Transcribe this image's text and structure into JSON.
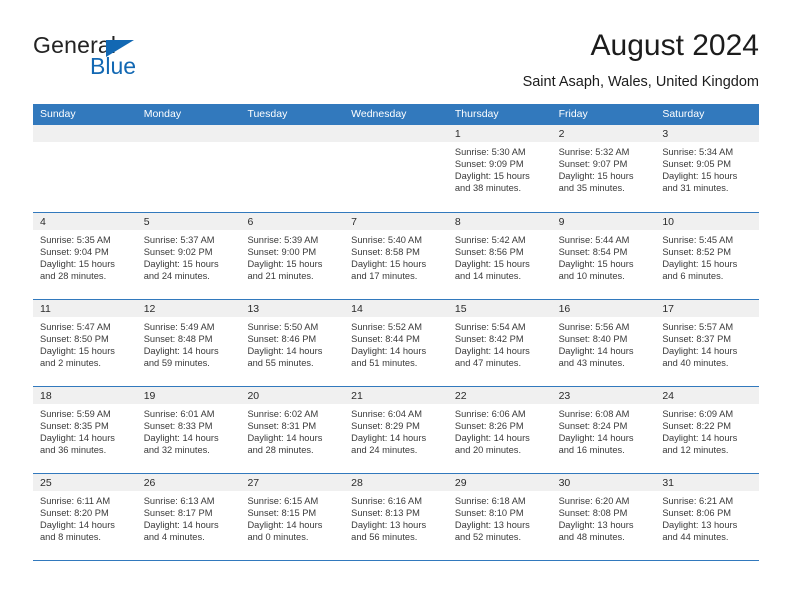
{
  "brand": {
    "name_top": "General",
    "name_bottom": "Blue",
    "accent_color": "#1268b3"
  },
  "header": {
    "title": "August 2024",
    "subtitle": "Saint Asaph, Wales, United Kingdom"
  },
  "calendar": {
    "header_bg": "#3279bd",
    "header_text_color": "#ffffff",
    "day_strip_bg": "#f0f0f0",
    "weekdays": [
      "Sunday",
      "Monday",
      "Tuesday",
      "Wednesday",
      "Thursday",
      "Friday",
      "Saturday"
    ],
    "weeks": [
      [
        {
          "day": "",
          "sunrise": "",
          "sunset": "",
          "daylight_line1": "",
          "daylight_line2": ""
        },
        {
          "day": "",
          "sunrise": "",
          "sunset": "",
          "daylight_line1": "",
          "daylight_line2": ""
        },
        {
          "day": "",
          "sunrise": "",
          "sunset": "",
          "daylight_line1": "",
          "daylight_line2": ""
        },
        {
          "day": "",
          "sunrise": "",
          "sunset": "",
          "daylight_line1": "",
          "daylight_line2": ""
        },
        {
          "day": "1",
          "sunrise": "Sunrise: 5:30 AM",
          "sunset": "Sunset: 9:09 PM",
          "daylight_line1": "Daylight: 15 hours",
          "daylight_line2": "and 38 minutes."
        },
        {
          "day": "2",
          "sunrise": "Sunrise: 5:32 AM",
          "sunset": "Sunset: 9:07 PM",
          "daylight_line1": "Daylight: 15 hours",
          "daylight_line2": "and 35 minutes."
        },
        {
          "day": "3",
          "sunrise": "Sunrise: 5:34 AM",
          "sunset": "Sunset: 9:05 PM",
          "daylight_line1": "Daylight: 15 hours",
          "daylight_line2": "and 31 minutes."
        }
      ],
      [
        {
          "day": "4",
          "sunrise": "Sunrise: 5:35 AM",
          "sunset": "Sunset: 9:04 PM",
          "daylight_line1": "Daylight: 15 hours",
          "daylight_line2": "and 28 minutes."
        },
        {
          "day": "5",
          "sunrise": "Sunrise: 5:37 AM",
          "sunset": "Sunset: 9:02 PM",
          "daylight_line1": "Daylight: 15 hours",
          "daylight_line2": "and 24 minutes."
        },
        {
          "day": "6",
          "sunrise": "Sunrise: 5:39 AM",
          "sunset": "Sunset: 9:00 PM",
          "daylight_line1": "Daylight: 15 hours",
          "daylight_line2": "and 21 minutes."
        },
        {
          "day": "7",
          "sunrise": "Sunrise: 5:40 AM",
          "sunset": "Sunset: 8:58 PM",
          "daylight_line1": "Daylight: 15 hours",
          "daylight_line2": "and 17 minutes."
        },
        {
          "day": "8",
          "sunrise": "Sunrise: 5:42 AM",
          "sunset": "Sunset: 8:56 PM",
          "daylight_line1": "Daylight: 15 hours",
          "daylight_line2": "and 14 minutes."
        },
        {
          "day": "9",
          "sunrise": "Sunrise: 5:44 AM",
          "sunset": "Sunset: 8:54 PM",
          "daylight_line1": "Daylight: 15 hours",
          "daylight_line2": "and 10 minutes."
        },
        {
          "day": "10",
          "sunrise": "Sunrise: 5:45 AM",
          "sunset": "Sunset: 8:52 PM",
          "daylight_line1": "Daylight: 15 hours",
          "daylight_line2": "and 6 minutes."
        }
      ],
      [
        {
          "day": "11",
          "sunrise": "Sunrise: 5:47 AM",
          "sunset": "Sunset: 8:50 PM",
          "daylight_line1": "Daylight: 15 hours",
          "daylight_line2": "and 2 minutes."
        },
        {
          "day": "12",
          "sunrise": "Sunrise: 5:49 AM",
          "sunset": "Sunset: 8:48 PM",
          "daylight_line1": "Daylight: 14 hours",
          "daylight_line2": "and 59 minutes."
        },
        {
          "day": "13",
          "sunrise": "Sunrise: 5:50 AM",
          "sunset": "Sunset: 8:46 PM",
          "daylight_line1": "Daylight: 14 hours",
          "daylight_line2": "and 55 minutes."
        },
        {
          "day": "14",
          "sunrise": "Sunrise: 5:52 AM",
          "sunset": "Sunset: 8:44 PM",
          "daylight_line1": "Daylight: 14 hours",
          "daylight_line2": "and 51 minutes."
        },
        {
          "day": "15",
          "sunrise": "Sunrise: 5:54 AM",
          "sunset": "Sunset: 8:42 PM",
          "daylight_line1": "Daylight: 14 hours",
          "daylight_line2": "and 47 minutes."
        },
        {
          "day": "16",
          "sunrise": "Sunrise: 5:56 AM",
          "sunset": "Sunset: 8:40 PM",
          "daylight_line1": "Daylight: 14 hours",
          "daylight_line2": "and 43 minutes."
        },
        {
          "day": "17",
          "sunrise": "Sunrise: 5:57 AM",
          "sunset": "Sunset: 8:37 PM",
          "daylight_line1": "Daylight: 14 hours",
          "daylight_line2": "and 40 minutes."
        }
      ],
      [
        {
          "day": "18",
          "sunrise": "Sunrise: 5:59 AM",
          "sunset": "Sunset: 8:35 PM",
          "daylight_line1": "Daylight: 14 hours",
          "daylight_line2": "and 36 minutes."
        },
        {
          "day": "19",
          "sunrise": "Sunrise: 6:01 AM",
          "sunset": "Sunset: 8:33 PM",
          "daylight_line1": "Daylight: 14 hours",
          "daylight_line2": "and 32 minutes."
        },
        {
          "day": "20",
          "sunrise": "Sunrise: 6:02 AM",
          "sunset": "Sunset: 8:31 PM",
          "daylight_line1": "Daylight: 14 hours",
          "daylight_line2": "and 28 minutes."
        },
        {
          "day": "21",
          "sunrise": "Sunrise: 6:04 AM",
          "sunset": "Sunset: 8:29 PM",
          "daylight_line1": "Daylight: 14 hours",
          "daylight_line2": "and 24 minutes."
        },
        {
          "day": "22",
          "sunrise": "Sunrise: 6:06 AM",
          "sunset": "Sunset: 8:26 PM",
          "daylight_line1": "Daylight: 14 hours",
          "daylight_line2": "and 20 minutes."
        },
        {
          "day": "23",
          "sunrise": "Sunrise: 6:08 AM",
          "sunset": "Sunset: 8:24 PM",
          "daylight_line1": "Daylight: 14 hours",
          "daylight_line2": "and 16 minutes."
        },
        {
          "day": "24",
          "sunrise": "Sunrise: 6:09 AM",
          "sunset": "Sunset: 8:22 PM",
          "daylight_line1": "Daylight: 14 hours",
          "daylight_line2": "and 12 minutes."
        }
      ],
      [
        {
          "day": "25",
          "sunrise": "Sunrise: 6:11 AM",
          "sunset": "Sunset: 8:20 PM",
          "daylight_line1": "Daylight: 14 hours",
          "daylight_line2": "and 8 minutes."
        },
        {
          "day": "26",
          "sunrise": "Sunrise: 6:13 AM",
          "sunset": "Sunset: 8:17 PM",
          "daylight_line1": "Daylight: 14 hours",
          "daylight_line2": "and 4 minutes."
        },
        {
          "day": "27",
          "sunrise": "Sunrise: 6:15 AM",
          "sunset": "Sunset: 8:15 PM",
          "daylight_line1": "Daylight: 14 hours",
          "daylight_line2": "and 0 minutes."
        },
        {
          "day": "28",
          "sunrise": "Sunrise: 6:16 AM",
          "sunset": "Sunset: 8:13 PM",
          "daylight_line1": "Daylight: 13 hours",
          "daylight_line2": "and 56 minutes."
        },
        {
          "day": "29",
          "sunrise": "Sunrise: 6:18 AM",
          "sunset": "Sunset: 8:10 PM",
          "daylight_line1": "Daylight: 13 hours",
          "daylight_line2": "and 52 minutes."
        },
        {
          "day": "30",
          "sunrise": "Sunrise: 6:20 AM",
          "sunset": "Sunset: 8:08 PM",
          "daylight_line1": "Daylight: 13 hours",
          "daylight_line2": "and 48 minutes."
        },
        {
          "day": "31",
          "sunrise": "Sunrise: 6:21 AM",
          "sunset": "Sunset: 8:06 PM",
          "daylight_line1": "Daylight: 13 hours",
          "daylight_line2": "and 44 minutes."
        }
      ]
    ]
  }
}
